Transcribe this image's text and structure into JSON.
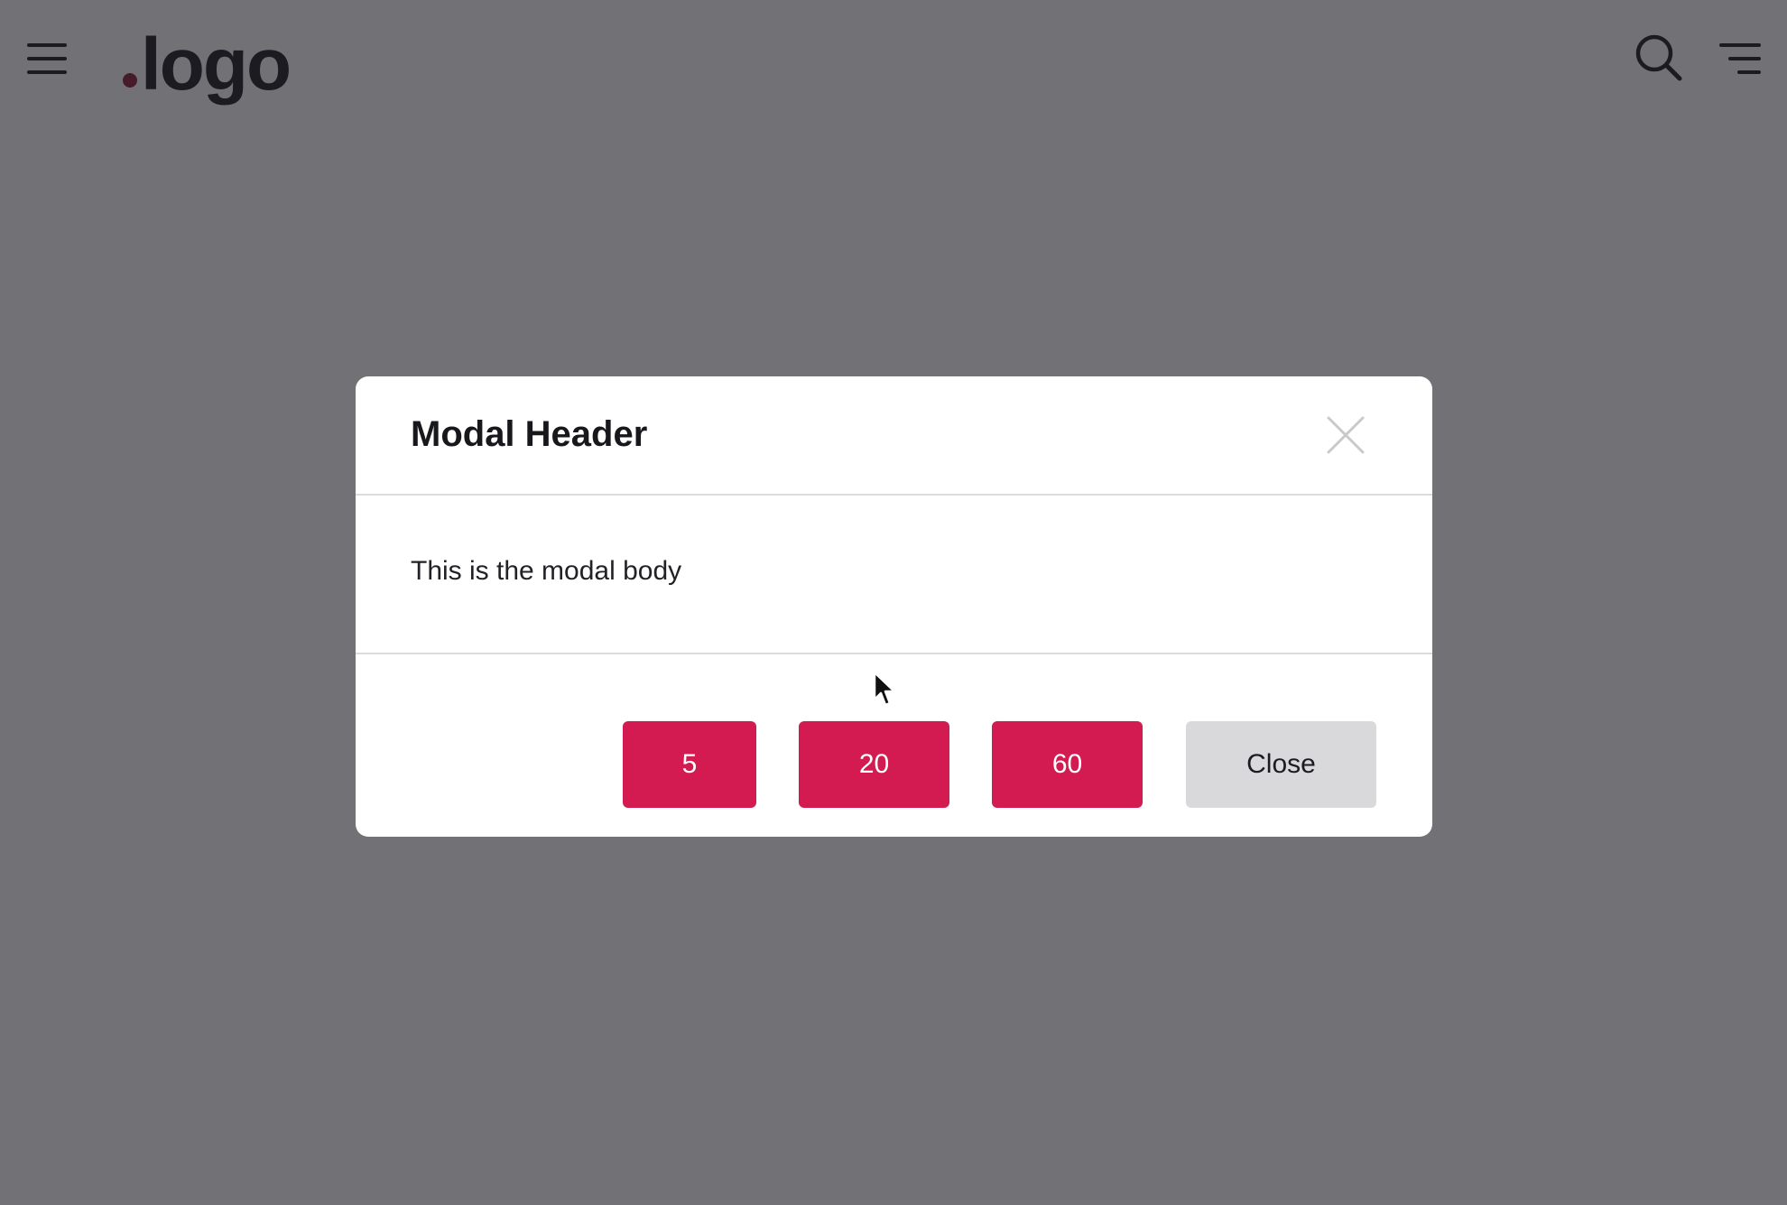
{
  "colors": {
    "accent": "#d31b52",
    "logo_dot": "#8c1e3a",
    "close_button_bg": "#d9d9dc",
    "text_dark": "#1e1d26",
    "close_icon": "#c9c9cc"
  },
  "header": {
    "menu_icon": "hamburger-menu-icon",
    "logo_text": "logo",
    "search_icon": "search-icon",
    "filter_icon": "filter-lines-icon"
  },
  "modal": {
    "title": "Modal Header",
    "close_icon": "close-icon",
    "body_text": "This is the modal body",
    "buttons": [
      {
        "label": "5"
      },
      {
        "label": "20"
      },
      {
        "label": "60"
      }
    ],
    "close_label": "Close"
  },
  "cursor_icon": "mouse-pointer-icon"
}
